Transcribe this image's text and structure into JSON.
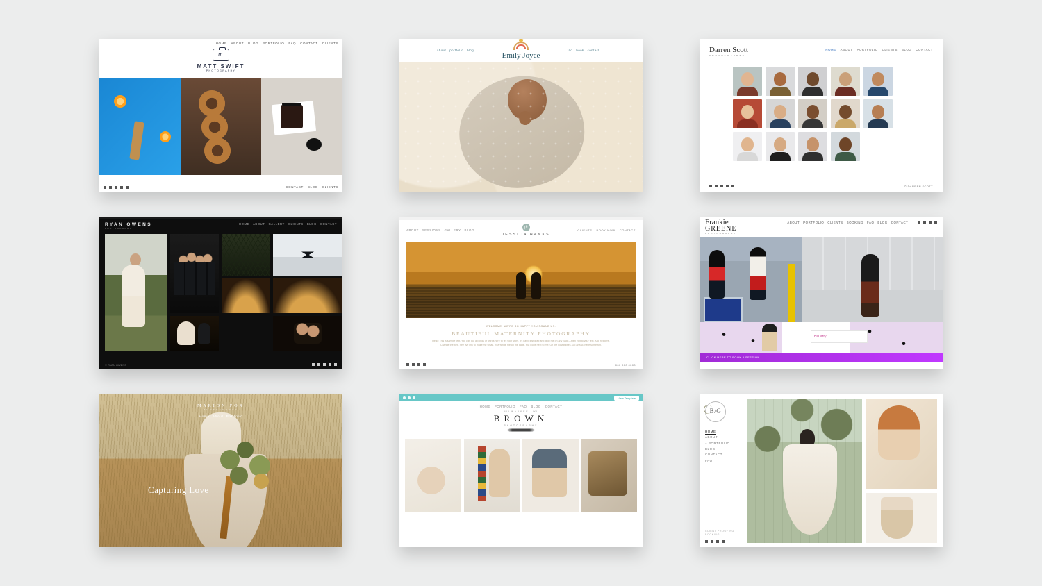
{
  "cards": [
    {
      "id": "matt-swift",
      "nav": [
        "HOME",
        "ABOUT",
        "BLOG",
        "PORTFOLIO",
        "FAQ",
        "CONTACT",
        "CLIENTS"
      ],
      "logo_title": "MATT SWIFT",
      "logo_sub": "PHOTOGRAPHY",
      "footer_right": [
        "CONTACT",
        "BLOG",
        "CLIENTS"
      ]
    },
    {
      "id": "emily-joyce",
      "nav_left": [
        "about",
        "portfolio",
        "blog"
      ],
      "nav_right": [
        "faq",
        "book",
        "contact"
      ],
      "logo_title": "Emily Joyce"
    },
    {
      "id": "darren-scott",
      "logo_title": "Darren Scott",
      "logo_sub": "PHOTOGRAPHER",
      "nav": [
        "HOME",
        "ABOUT",
        "PORTFOLIO",
        "CLIENTS",
        "BLOG",
        "CONTACT"
      ],
      "footer_right": "© DARREN SCOTT"
    },
    {
      "id": "ryan-owens",
      "logo_title": "RYAN OWENS",
      "logo_sub": "PHOTOGRAPHY",
      "nav": [
        "HOME",
        "ABOUT",
        "GALLERY",
        "CLIENTS",
        "BLOG",
        "CONTACT"
      ],
      "footer_left": "© RYAN OWENS"
    },
    {
      "id": "jessica-hanks",
      "nav_left": [
        "ABOUT",
        "SESSIONS",
        "GALLERY",
        "BLOG"
      ],
      "nav_right": [
        "CLIENTS",
        "BOOK NOW",
        "CONTACT"
      ],
      "logo_title": "JESSICA HANKS",
      "welcome": "WELCOME! WE'RE SO HAPPY YOU FOUND US.",
      "headline": "BEAUTIFUL MATERNITY PHOTOGRAPHY",
      "body": "Hello! This is sample text. You can put all kinds of words here to tell your story. It's easy, just drag and drop me on any page—then edit to your text. Add headers. Change the font. See live link to make me small. Rearrange me on the page. Put icons next to me. Oh the possibilities. Go ahead, have some fun."
    },
    {
      "id": "frankie-greene",
      "logo_line1": "Frankie",
      "logo_line2": "GREENE",
      "logo_sub": "PHOTOGRAPHY",
      "nav": [
        "ABOUT",
        "PORTFOLIO",
        "CLIENTS",
        "BOOKING",
        "FAQ",
        "BLOG",
        "CONTACT"
      ],
      "chip": "Hi Larry!",
      "purple_bar": "CLICK HERE TO BOOK A SESSION"
    },
    {
      "id": "marion-fox",
      "logo_title": "MARION FOX",
      "logo_sub": "PHOTOGRAPHY",
      "nav": [
        "Home",
        "About",
        "Portfolio"
      ],
      "tagline": "Capturing Love"
    },
    {
      "id": "brown",
      "mac_button": "View Template",
      "nav": [
        "HOME",
        "PORTFOLIO",
        "FAQ",
        "BLOG",
        "CONTACT"
      ],
      "logo_pre": "MILWAUKEE, WI",
      "logo_title": "BROWN",
      "logo_sub": "PHOTOGRAPHY"
    },
    {
      "id": "bg",
      "monogram": "b/g",
      "nav": [
        "HOME",
        "ABOUT",
        "+ PORTFOLIO",
        "BLOG",
        "CONTACT",
        "FAQ"
      ],
      "footer": [
        "CLIENT PROOFING",
        "BOOKING"
      ]
    }
  ]
}
